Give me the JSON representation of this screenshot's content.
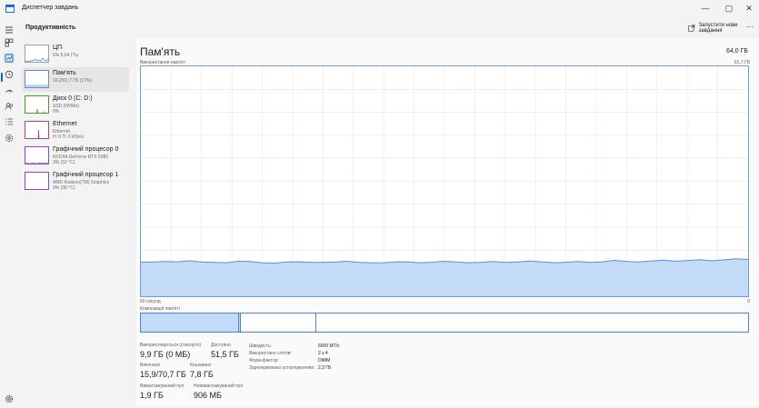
{
  "window": {
    "title": "Диспетчер завдань",
    "controls": {
      "minimize": "—",
      "maximize": "▢",
      "close": "✕"
    }
  },
  "rail": {
    "icons": [
      "hamburger-menu-icon",
      "processes-icon",
      "performance-icon",
      "app-history-icon",
      "startup-apps-icon",
      "users-icon",
      "details-icon",
      "services-icon",
      "settings-icon"
    ],
    "active": "performance-icon"
  },
  "header": {
    "title": "Продуктивність",
    "new_task_label": "Запустити нове завдання",
    "more_label": "···"
  },
  "sidebar": {
    "items": [
      {
        "title": "ЦП",
        "line1": "6%  5,04 ГГц",
        "line2": "",
        "line3": "",
        "selected": false,
        "color": "#2a86c8"
      },
      {
        "title": "Пам'ять",
        "line1": "10,2/61,7 ГБ (17%)",
        "line2": "",
        "line3": "",
        "selected": true,
        "color": "#6b88c9"
      },
      {
        "title": "Диск 0 (C: D:)",
        "line1": "SSD (NVMe)",
        "line2": "0%",
        "line3": "",
        "selected": false,
        "color": "#4c9a2a"
      },
      {
        "title": "Ethernet",
        "line1": "Ethernet",
        "line2": "Н: 0  П: 0 Кбіт/с",
        "line3": "",
        "selected": false,
        "color": "#b0408a"
      },
      {
        "title": "Графічний процесор 0",
        "line1": "NVIDIA GeForce RTX 5080",
        "line2": "3%  (32 °C)",
        "line3": "",
        "selected": false,
        "color": "#8a4ab5"
      },
      {
        "title": "Графічний процесор 1",
        "line1": "AMD Radeon(TM) Graphics",
        "line2": "0%  (38 °C)",
        "line3": "",
        "selected": false,
        "color": "#8a4ab5"
      }
    ]
  },
  "main": {
    "title": "Пам'ять",
    "total": "64,0 ГБ",
    "usage_label": "Використання пам'яті",
    "usage_max": "61,7 ГБ",
    "time_left": "60 секунд",
    "time_right": "0",
    "composition_label": "Композиція пам'яті",
    "composition": {
      "in_use_fraction": 0.161,
      "modified_fraction": 0.003,
      "standby_fraction": 0.124
    },
    "usage_fractions": [
      0.148,
      0.149,
      0.151,
      0.15,
      0.154,
      0.149,
      0.147,
      0.146,
      0.152,
      0.151,
      0.146,
      0.144,
      0.149,
      0.15,
      0.148,
      0.147,
      0.149,
      0.152,
      0.147,
      0.145,
      0.146,
      0.15,
      0.149,
      0.146,
      0.148,
      0.152,
      0.149,
      0.146,
      0.148,
      0.151,
      0.147,
      0.149,
      0.153,
      0.15,
      0.146,
      0.148,
      0.151,
      0.147,
      0.15,
      0.156,
      0.151,
      0.149,
      0.153,
      0.157,
      0.152,
      0.155,
      0.159,
      0.154,
      0.158,
      0.163,
      0.16
    ],
    "stats": {
      "in_use_label": "Використовується (стиснуто)",
      "in_use_value": "9,9 ГБ (0 МБ)",
      "available_label": "Доступно",
      "available_value": "51,5 ГБ",
      "committed_label": "Виконано",
      "committed_value": "15,9/70,7 ГБ",
      "cached_label": "Кешовано",
      "cached_value": "7,8 ГБ",
      "paged_label": "Вивантажуваний пул",
      "paged_value": "1,9 ГБ",
      "nonpaged_label": "Невивантажуваний пул",
      "nonpaged_value": "906 МБ"
    },
    "specs": [
      {
        "label": "Швидкість:",
        "value": "6000 МТ/с"
      },
      {
        "label": "Використано слотів:",
        "value": "2 з 4"
      },
      {
        "label": "Форм-фактор:",
        "value": "DIMM"
      },
      {
        "label": "Зарезервовано устаткуванням:",
        "value": "2,3 ГБ"
      }
    ]
  }
}
